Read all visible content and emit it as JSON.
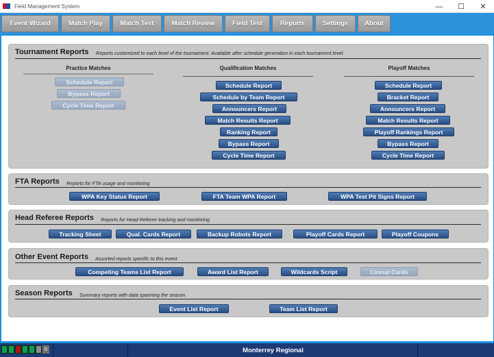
{
  "window": {
    "title": "Field Management System"
  },
  "nav": {
    "tabs": [
      "Event Wizard",
      "Match Play",
      "Match Test",
      "Match Review",
      "Field Test",
      "Reports",
      "Settings",
      "About"
    ]
  },
  "sections": {
    "tournament": {
      "title": "Tournament Reports",
      "desc": "Reports customized to each level of the tournament. Available after schedule generation in each tournament level.",
      "practice": {
        "heading": "Practice Matches",
        "buttons": [
          "Schedule Report",
          "Bypass Report",
          "Cycle Time Report"
        ]
      },
      "qualification": {
        "heading": "Qualification Matches",
        "buttons": [
          "Schedule Report",
          "Schedule by Team Report",
          "Announcers Report",
          "Match Results Report",
          "Ranking Report",
          "Bypass Report",
          "Cycle Time Report"
        ]
      },
      "playoff": {
        "heading": "Playoff Matches",
        "buttons": [
          "Schedule Report",
          "Bracket Report",
          "Announcers Report",
          "Match Results Report",
          "Playoff Rankings Report",
          "Bypass Report",
          "Cycle Time Report"
        ]
      }
    },
    "fta": {
      "title": "FTA Reports",
      "desc": "Reports for FTA usage and monitoring",
      "buttons": [
        "WPA Key Status Report",
        "FTA Team WPA Report",
        "WPA Test Pit Signs Report"
      ]
    },
    "head_referee": {
      "title": "Head Referee Reports",
      "desc": "Reports for Head Referee tracking and monitoring",
      "buttons": [
        "Tracking Sheet",
        "Qual. Cards Report",
        "Backup Robots Report",
        "Playoff Cards Report",
        "Playoff Coupons"
      ]
    },
    "other": {
      "title": "Other Event Reports",
      "desc": "Assorted reports specific to this event",
      "buttons": [
        "Competing Teams List Report",
        "Award List Report",
        "Wildcards Script",
        "Lineup Cards"
      ]
    },
    "season": {
      "title": "Season Reports",
      "desc": "Summary reports with data spanning the season",
      "buttons": [
        "Event List Report",
        "Team List Report"
      ]
    }
  },
  "status": {
    "event_name": "Monterrey Regional",
    "count": "0"
  }
}
